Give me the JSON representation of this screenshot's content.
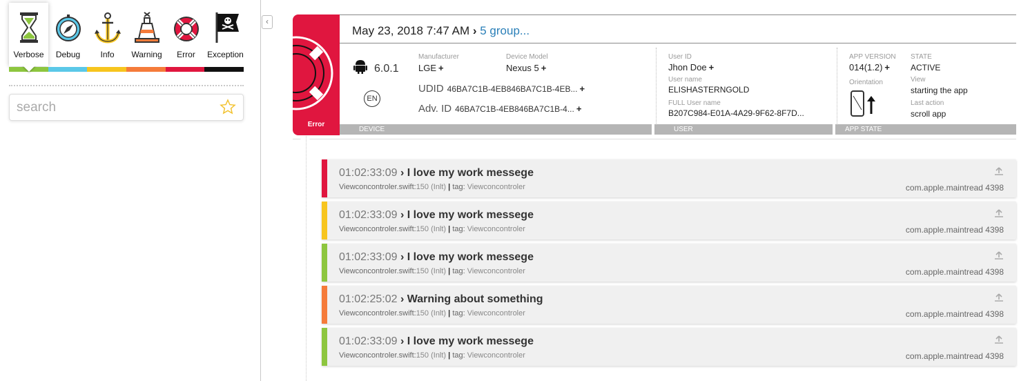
{
  "filters": [
    {
      "label": "Verbose",
      "icon": "hourglass-icon",
      "color": "#8dc63f",
      "active": true
    },
    {
      "label": "Debug",
      "icon": "compass-icon",
      "color": "#5bc8e8"
    },
    {
      "label": "Info",
      "icon": "anchor-icon",
      "color": "#f7c51e"
    },
    {
      "label": "Warning",
      "icon": "buoy-icon",
      "color": "#f57b3a"
    },
    {
      "label": "Error",
      "icon": "lifebuoy-icon",
      "color": "#e0163f"
    },
    {
      "label": "Exception",
      "icon": "pirate-flag-icon",
      "color": "#111111"
    }
  ],
  "search": {
    "placeholder": "search"
  },
  "header": {
    "date": "May 23, 2018 7:47 AM",
    "separator": "›",
    "group": "5 group...",
    "badge_label": "Error",
    "device": {
      "section_label": "DEVICE",
      "os_version": "6.0.1",
      "language": "EN",
      "manufacturer_label": "Manufacturer",
      "manufacturer": "LGE",
      "model_label": "Device Model",
      "model": "Nexus 5",
      "udid_label": "UDID",
      "udid": "46BA7C1B-4EB846BA7C1B-4EB...",
      "adv_label": "Adv. ID",
      "adv_id": "46BA7C1B-4EB846BA7C1B-4..."
    },
    "user": {
      "section_label": "USER",
      "user_id_label": "User ID",
      "user_id": "Jhon Doe",
      "user_name_label": "User name",
      "user_name": "ELISHASTERNGOLD",
      "full_name_label": "FULL User name",
      "full_name": "B207C984-E01A-4A29-9F62-8F7D..."
    },
    "app_state": {
      "section_label": "APP STATE",
      "version_label": "APP VERSION",
      "version": "014(1.2)",
      "orientation_label": "Orientation",
      "state_label": "STATE",
      "state": "ACTIVE",
      "view_label": "View",
      "view": "starting the app",
      "last_action_label": "Last action",
      "last_action": "scroll app"
    },
    "plus": "+"
  },
  "logs": [
    {
      "time": "01:02:33:09",
      "message": "I love my work messege",
      "file": "Viewconcontroler.swift:",
      "line": "150 (Inlt)",
      "tag_label": "tag:",
      "tag": "Viewconcontroler",
      "thread": "com.apple.maintread 4398",
      "color": "#e0163f"
    },
    {
      "time": "01:02:33:09",
      "message": "I love my work messege",
      "file": "Viewconcontroler.swift:",
      "line": "150 (Inlt)",
      "tag_label": "tag:",
      "tag": "Viewconcontroler",
      "thread": "com.apple.maintread 4398",
      "color": "#f7c51e"
    },
    {
      "time": "01:02:33:09",
      "message": "I love my work messege",
      "file": "Viewconcontroler.swift:",
      "line": "150 (Inlt)",
      "tag_label": "tag:",
      "tag": "Viewconcontroler",
      "thread": "com.apple.maintread 4398",
      "color": "#8dc63f"
    },
    {
      "time": "01:02:25:02",
      "message": "Warning about something",
      "file": "Viewconcontroler.swift:",
      "line": "150 (Inlt)",
      "tag_label": "tag:",
      "tag": "Viewconcontroler",
      "thread": "com.apple.maintread 4398",
      "color": "#f57b3a"
    },
    {
      "time": "01:02:33:09",
      "message": "I love my work messege",
      "file": "Viewconcontroler.swift:",
      "line": "150 (Inlt)",
      "tag_label": "tag:",
      "tag": "Viewconcontroler",
      "thread": "com.apple.maintread 4398",
      "color": "#8dc63f"
    }
  ]
}
